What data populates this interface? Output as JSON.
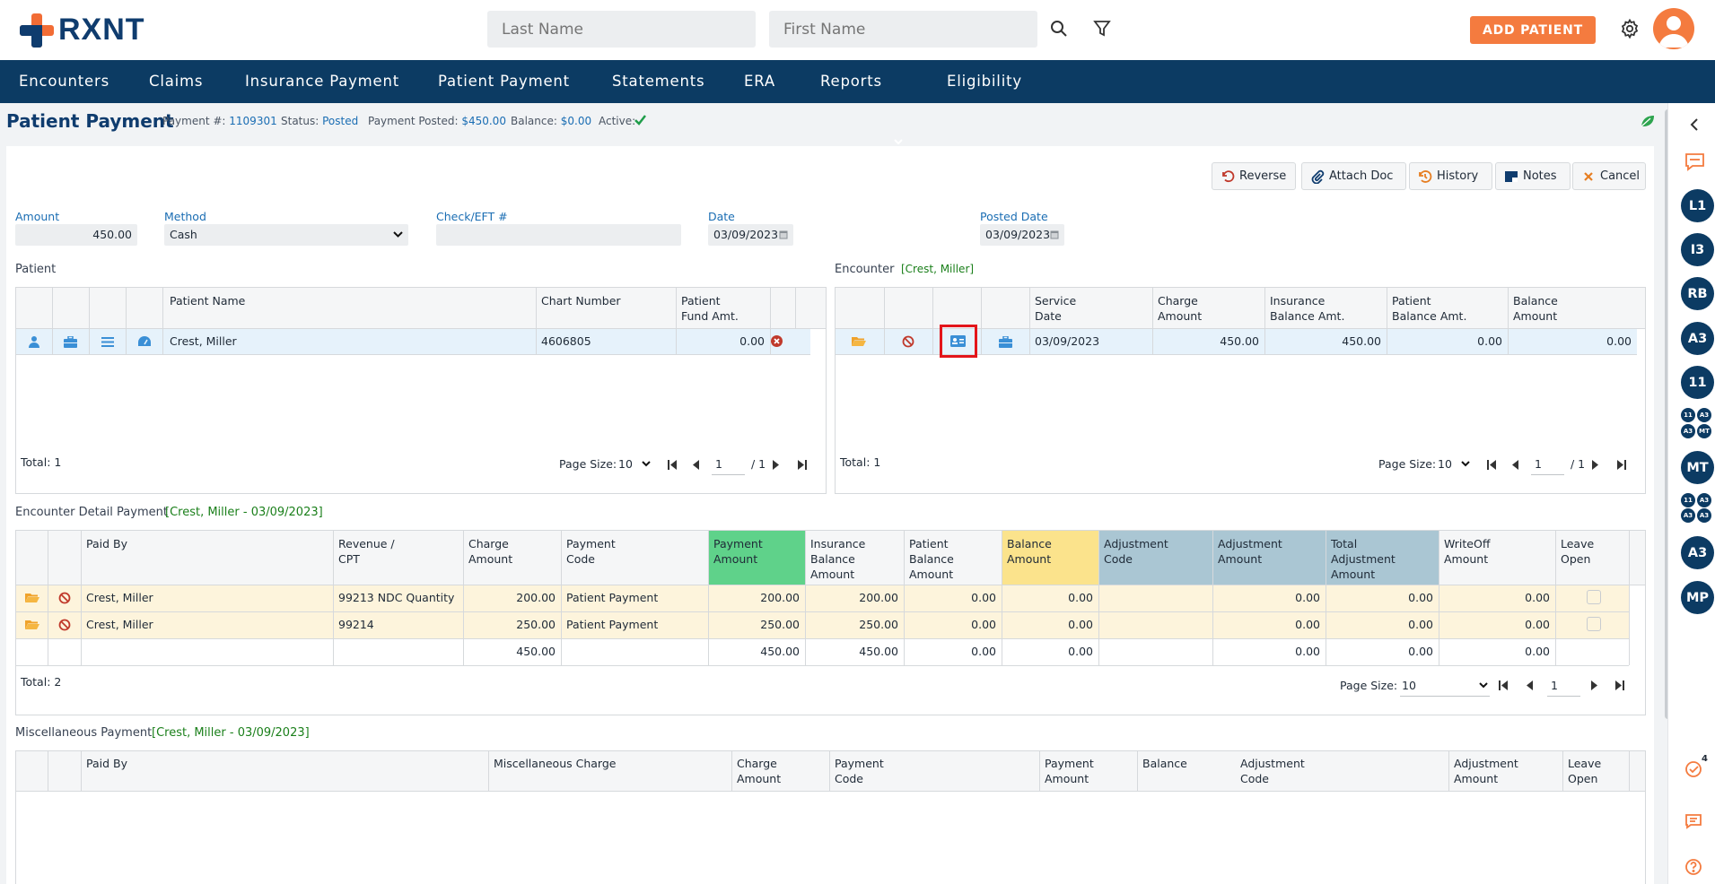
{
  "app": {
    "logo_text": "RXNT"
  },
  "search": {
    "last_name_placeholder": "Last Name",
    "first_name_placeholder": "First Name"
  },
  "topbar": {
    "add_patient_label": "ADD PATIENT"
  },
  "nav": [
    "Encounters",
    "Claims",
    "Insurance Payment",
    "Patient Payment",
    "Statements",
    "ERA",
    "Reports",
    "Eligibility"
  ],
  "header": {
    "title": "Patient Payment",
    "payment_label": "Payment #:",
    "payment_number": "1109301",
    "status_label": "Status:",
    "status": "Posted",
    "posted_label": "Payment Posted:",
    "posted_amount": "$450.00",
    "balance_label": "Balance:",
    "balance": "$0.00",
    "active_label": "Active:"
  },
  "toolbar": {
    "reverse": "Reverse",
    "attach": "Attach Doc",
    "history": "History",
    "notes": "Notes",
    "cancel": "Cancel"
  },
  "form": {
    "amount_label": "Amount",
    "amount": "450.00",
    "method_label": "Method",
    "method": "Cash",
    "check_label": "Check/EFT #",
    "check": "",
    "date_label": "Date",
    "date": "03/09/2023",
    "posted_date_label": "Posted Date",
    "posted_date": "03/09/2023"
  },
  "patient": {
    "section_label": "Patient",
    "headers": {
      "name": "Patient Name",
      "chart": "Chart Number",
      "fund1": "Patient",
      "fund2": "Fund Amt."
    },
    "row": {
      "name": "Crest, Miller",
      "chart": "4606805",
      "fund": "0.00"
    },
    "total": "Total: 1",
    "page_size_label": "Page Size:",
    "page_size": "10",
    "page": "1",
    "pages": "/ 1"
  },
  "encounter": {
    "section_label": "Encounter",
    "section_tag": "[Crest, Miller]",
    "headers": {
      "sd1": "Service",
      "sd2": "Date",
      "ca1": "Charge",
      "ca2": "Amount",
      "ib1": "Insurance",
      "ib2": "Balance Amt.",
      "pb1": "Patient",
      "pb2": "Balance Amt.",
      "ba1": "Balance",
      "ba2": "Amount"
    },
    "row": {
      "service_date": "03/09/2023",
      "charge": "450.00",
      "ins_bal": "450.00",
      "pat_bal": "0.00",
      "balance": "0.00"
    },
    "total": "Total: 1",
    "page_size_label": "Page Size:",
    "page_size": "10",
    "page": "1",
    "pages": "/ 1"
  },
  "detail": {
    "section_label": "Encounter Detail Payment",
    "section_tag": "[Crest, Miller - 03/09/2023]",
    "headers": {
      "paid_by": "Paid By",
      "rev1": "Revenue /",
      "rev2": "CPT",
      "ca1": "Charge",
      "ca2": "Amount",
      "pc1": "Payment",
      "pc2": "Code",
      "pa1": "Payment",
      "pa2": "Amount",
      "ib1": "Insurance",
      "ib2": "Balance",
      "ib3": "Amount",
      "pb1": "Patient",
      "pb2": "Balance",
      "pb3": "Amount",
      "ba1": "Balance",
      "ba2": "Amount",
      "ac1": "Adjustment",
      "ac2": "Code",
      "aa1": "Adjustment",
      "aa2": "Amount",
      "ta1": "Total",
      "ta2": "Adjustment",
      "ta3": "Amount",
      "wo1": "WriteOff",
      "wo2": "Amount",
      "lo1": "Leave",
      "lo2": "Open"
    },
    "rows": [
      {
        "paid_by": "Crest, Miller",
        "cpt": "99213 NDC Quantity",
        "charge": "200.00",
        "code": "Patient Payment",
        "pay": "200.00",
        "ins": "200.00",
        "pat": "0.00",
        "bal": "0.00",
        "adj": "0.00",
        "tot": "0.00",
        "wo": "0.00"
      },
      {
        "paid_by": "Crest, Miller",
        "cpt": "99214",
        "charge": "250.00",
        "code": "Patient Payment",
        "pay": "250.00",
        "ins": "250.00",
        "pat": "0.00",
        "bal": "0.00",
        "adj": "0.00",
        "tot": "0.00",
        "wo": "0.00"
      }
    ],
    "totals": {
      "charge": "450.00",
      "pay": "450.00",
      "ins": "450.00",
      "pat": "0.00",
      "bal": "0.00",
      "adj": "0.00",
      "tot": "0.00",
      "wo": "0.00"
    },
    "total": "Total: 2",
    "page_size_label": "Page Size:",
    "page_size": "10",
    "page": "1"
  },
  "misc": {
    "section_label": "Miscellaneous Payment",
    "section_tag": "[Crest, Miller - 03/09/2023]",
    "headers": {
      "paid_by": "Paid By",
      "charge": "Miscellaneous Charge",
      "ca1": "Charge",
      "ca2": "Amount",
      "pc1": "Payment",
      "pc2": "Code",
      "pa1": "Payment",
      "pa2": "Amount",
      "bal": "Balance",
      "ac1": "Adjustment",
      "ac2": "Code",
      "aa1": "Adjustment",
      "aa2": "Amount",
      "lo1": "Leave",
      "lo2": "Open"
    }
  },
  "rail": {
    "avatars": [
      "L1",
      "I3",
      "RB",
      "A3",
      "11",
      "MT",
      "A3",
      "MP"
    ],
    "mini_group_1": [
      "11",
      "A3",
      "A3",
      "MT"
    ],
    "mini_group_2": [
      "11",
      "A3",
      "A3",
      "A3"
    ],
    "task_badge": "4"
  },
  "colors": {
    "nav": "#0c3b63",
    "accent": "#f47b3f",
    "link": "#1a6db3",
    "green": "#1a7f1a",
    "payment_header": "#5fd28a",
    "balance_header": "#fbe38c",
    "adjustment_header": "#aac6d3",
    "row_highlight": "#fdf4dc"
  }
}
